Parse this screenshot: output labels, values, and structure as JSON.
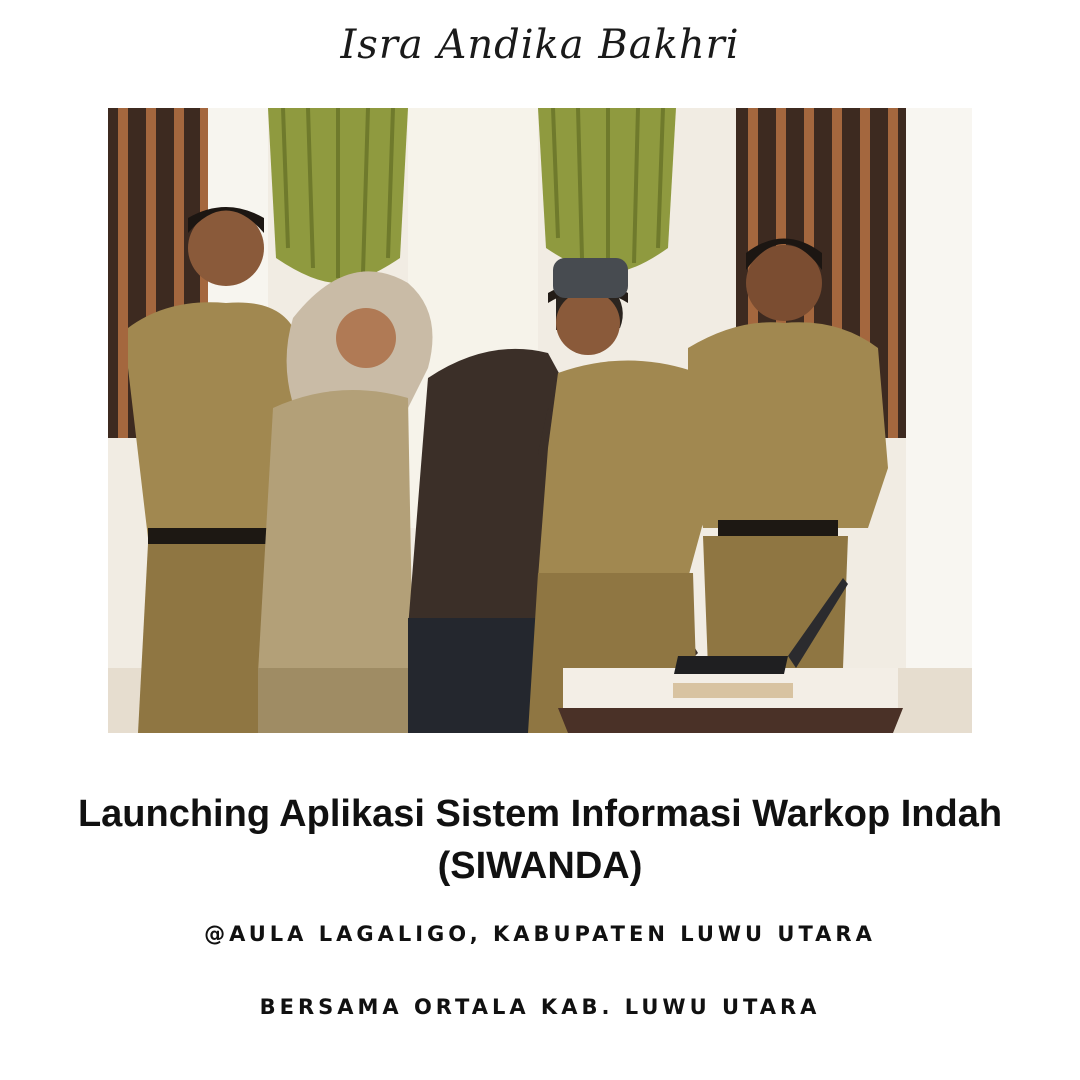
{
  "signature": "Isra Andika Bakhri",
  "photo": {
    "alt": ""
  },
  "title": {
    "line1": "Launching Aplikasi Sistem Informasi Warkop Indah",
    "line2": "(SIWANDA)"
  },
  "location": "@AULA LAGALIGO, KABUPATEN LUWU UTARA",
  "with": "BERSAMA ORTALA KAB. LUWU UTARA",
  "colors": {
    "background": "#ffffff",
    "text": "#111111",
    "uniform": "#a18850",
    "curtain": "#8f9a3f",
    "wall_stripe": "#3b2a22"
  }
}
